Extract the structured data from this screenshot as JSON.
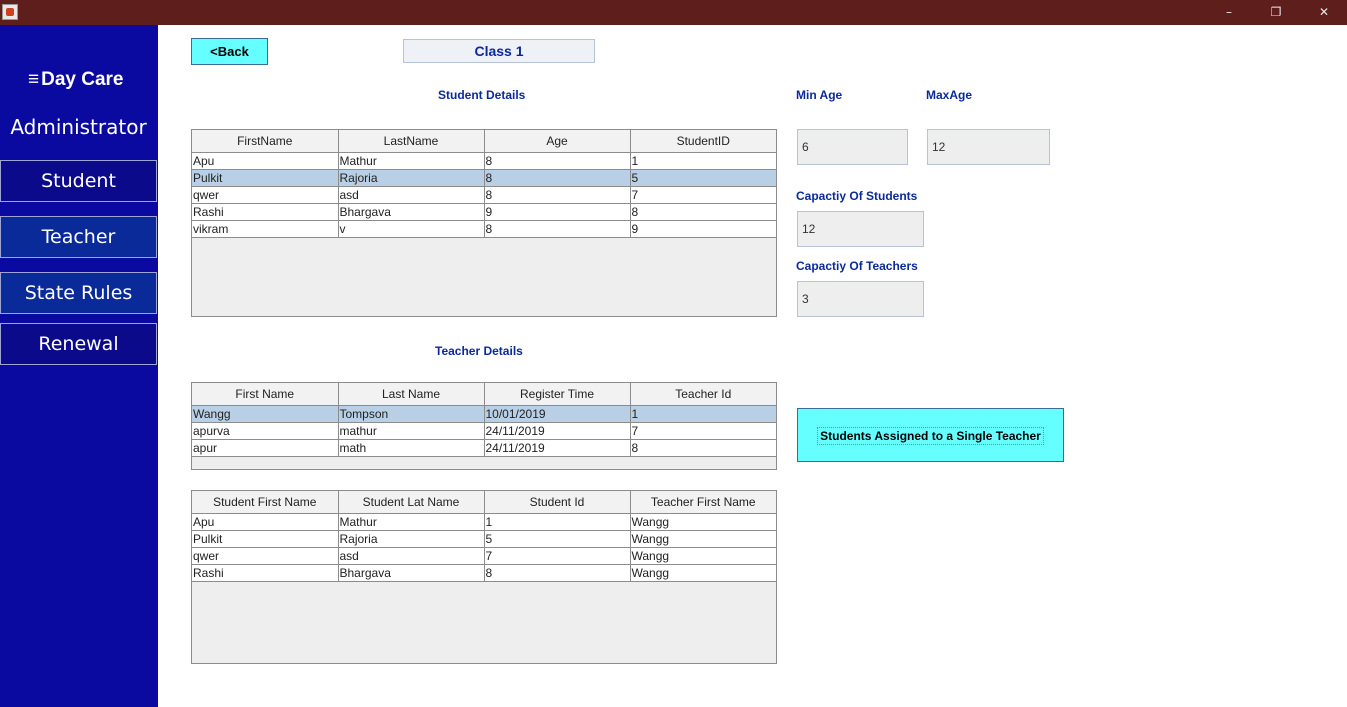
{
  "window": {
    "controls": {
      "minimize": "–",
      "restore": "❐",
      "close": "✕"
    }
  },
  "sidebar": {
    "brand": "Day Care",
    "brand_icon": "≡",
    "section_label": "Administrator",
    "items": [
      {
        "label": "Student"
      },
      {
        "label": "Teacher"
      },
      {
        "label": "State Rules"
      },
      {
        "label": "Renewal"
      }
    ]
  },
  "header": {
    "back_label": "<Back",
    "class_title": "Class 1"
  },
  "student_details": {
    "title": "Student Details",
    "columns": [
      "FirstName",
      "LastName",
      "Age",
      "StudentID"
    ],
    "rows": [
      [
        "Apu",
        "Mathur",
        "8",
        "1"
      ],
      [
        "Pulkit",
        "Rajoria",
        "8",
        "5"
      ],
      [
        "qwer",
        "asd",
        "8",
        "7"
      ],
      [
        "Rashi",
        "Bhargava",
        "9",
        "8"
      ],
      [
        "vikram",
        "v",
        "8",
        "9"
      ]
    ],
    "selected_row": 1
  },
  "teacher_details": {
    "title": "Teacher Details",
    "columns": [
      "First Name",
      "Last Name",
      "Register Time",
      "Teacher Id"
    ],
    "rows": [
      [
        "Wangg",
        "Tompson",
        "10/01/2019",
        "1"
      ],
      [
        "apurva",
        "mathur",
        "24/11/2019",
        "7"
      ],
      [
        "apur",
        "math",
        "24/11/2019",
        "8"
      ]
    ],
    "selected_row": 0
  },
  "assignments": {
    "columns": [
      "Student First Name",
      "Student Lat Name",
      "Student Id",
      "Teacher First Name"
    ],
    "rows": [
      [
        "Apu",
        "Mathur",
        "1",
        "Wangg"
      ],
      [
        "Pulkit",
        "Rajoria",
        "5",
        "Wangg"
      ],
      [
        "qwer",
        "asd",
        "7",
        "Wangg"
      ],
      [
        "Rashi",
        "Bhargava",
        "8",
        "Wangg"
      ]
    ]
  },
  "rules": {
    "min_age_label": "Min Age",
    "min_age_value": "6",
    "max_age_label": "MaxAge",
    "max_age_value": "12",
    "capacity_students_label": "Capactiy Of Students",
    "capacity_students_value": "12",
    "capacity_teachers_label": "Capactiy Of Teachers",
    "capacity_teachers_value": "3"
  },
  "actions": {
    "assign_label": "Students Assigned to a Single Teacher"
  }
}
